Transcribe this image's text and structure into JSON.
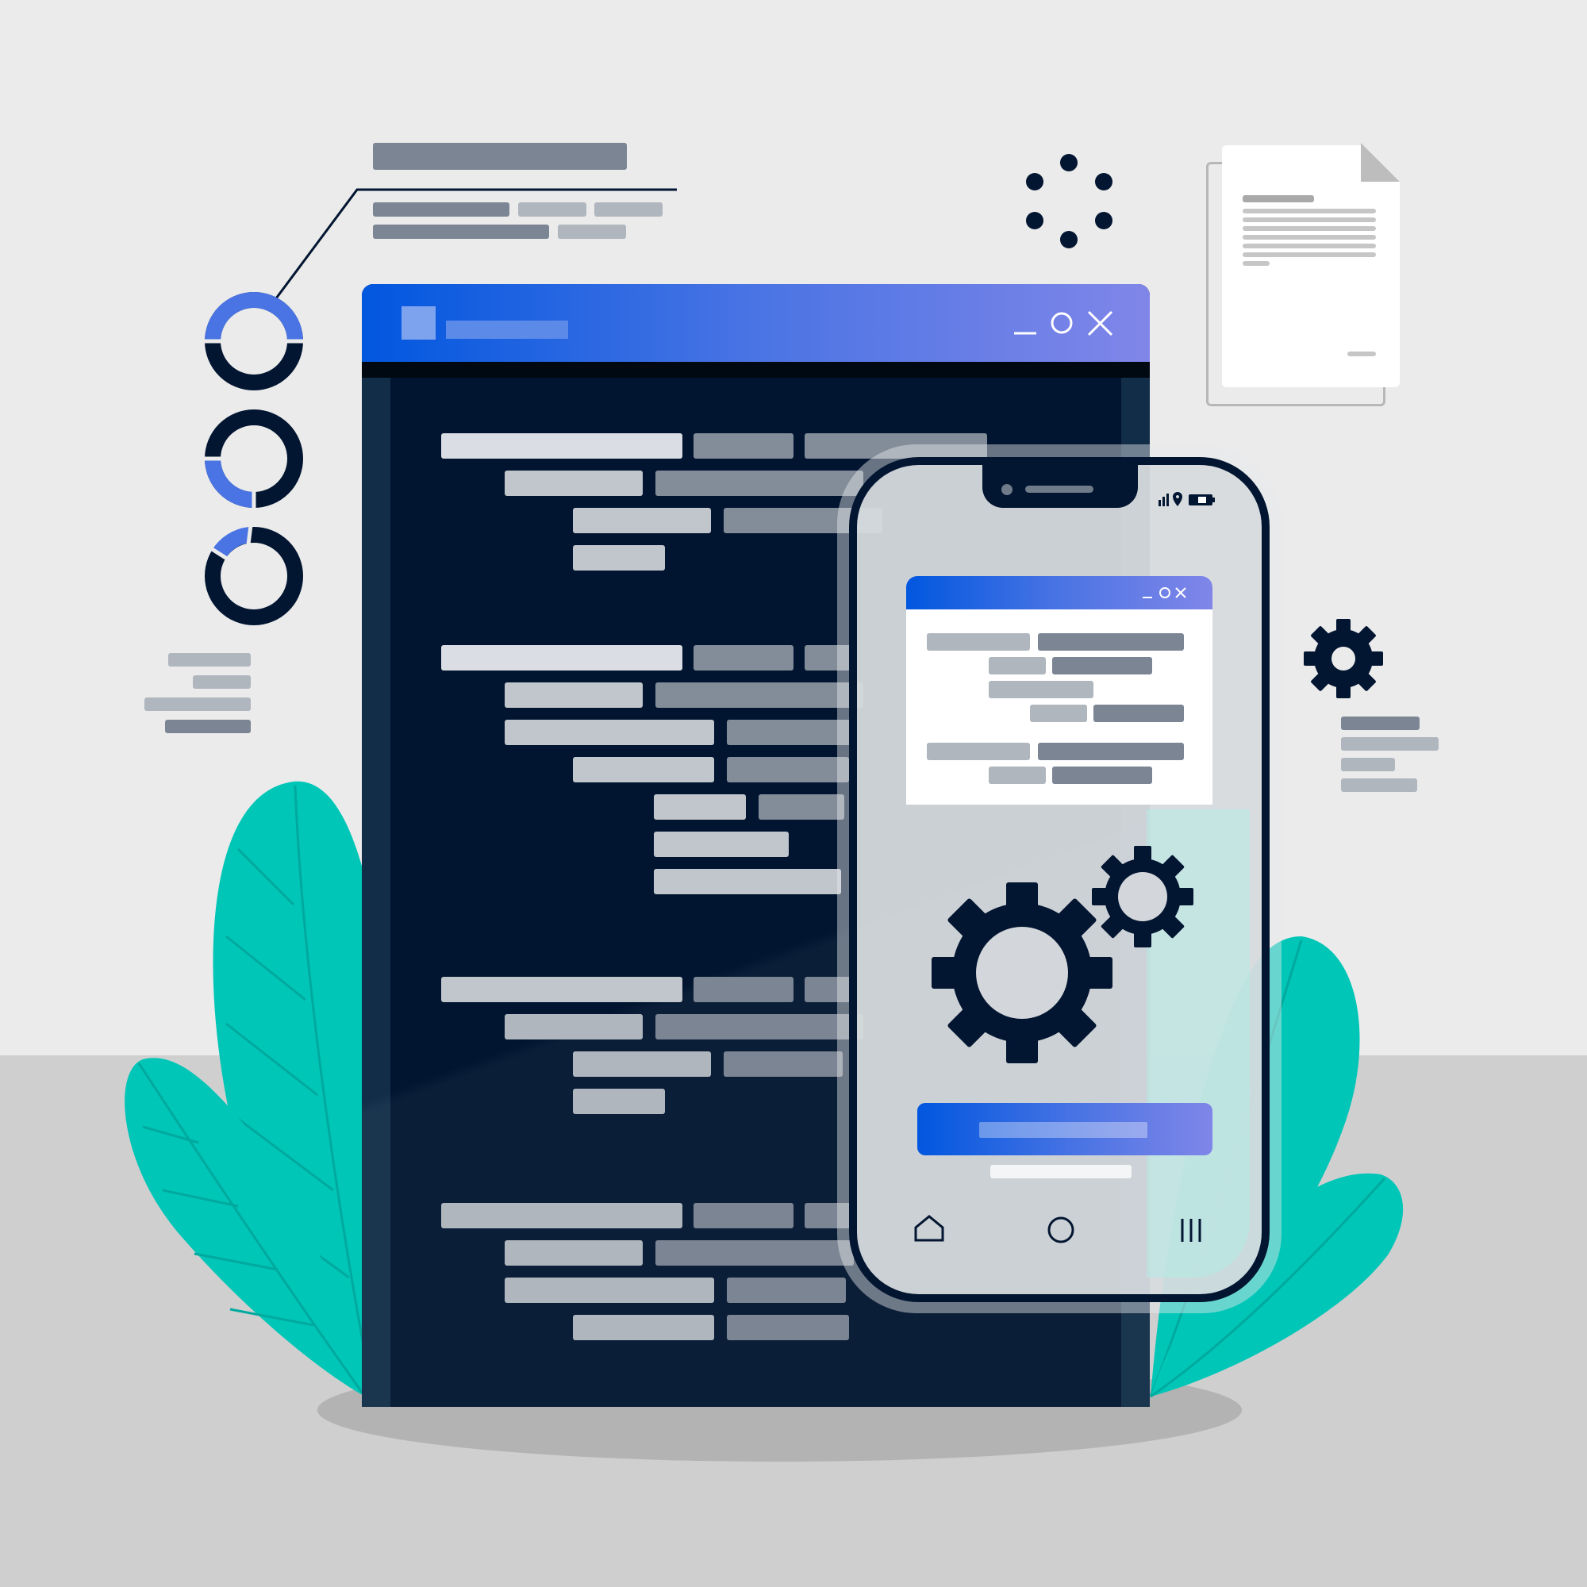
{
  "scene": {
    "description_tags": [
      "code-window",
      "smartphone",
      "gears",
      "donut-indicators",
      "document",
      "leaves"
    ],
    "colors": {
      "navy": "#021531",
      "blue_start": "#0157df",
      "blue_end": "#8086e8",
      "teal": "#00c6b7",
      "teal_dark": "#00a99e",
      "wall": "#ebebeb",
      "floor": "#cfcfcf"
    }
  },
  "code_window": {
    "controls": [
      "minimize-icon",
      "maximize-icon",
      "close-icon"
    ],
    "line_groups": 4
  },
  "phone": {
    "status_icons": [
      "signal-icon",
      "location-icon",
      "battery-icon"
    ],
    "mini_window_controls": [
      "minimize-icon",
      "maximize-icon",
      "close-icon"
    ],
    "nav_icons": [
      "home-icon",
      "circle-home-icon",
      "recents-icon"
    ],
    "gears": [
      "large-gear-icon",
      "small-gear-icon"
    ]
  },
  "side_widgets": {
    "donuts": [
      "donut-progress-1",
      "donut-progress-2",
      "donut-progress-3"
    ],
    "loader": "loading-dots-icon",
    "gear": "settings-gear-icon",
    "document": "document-icon"
  }
}
